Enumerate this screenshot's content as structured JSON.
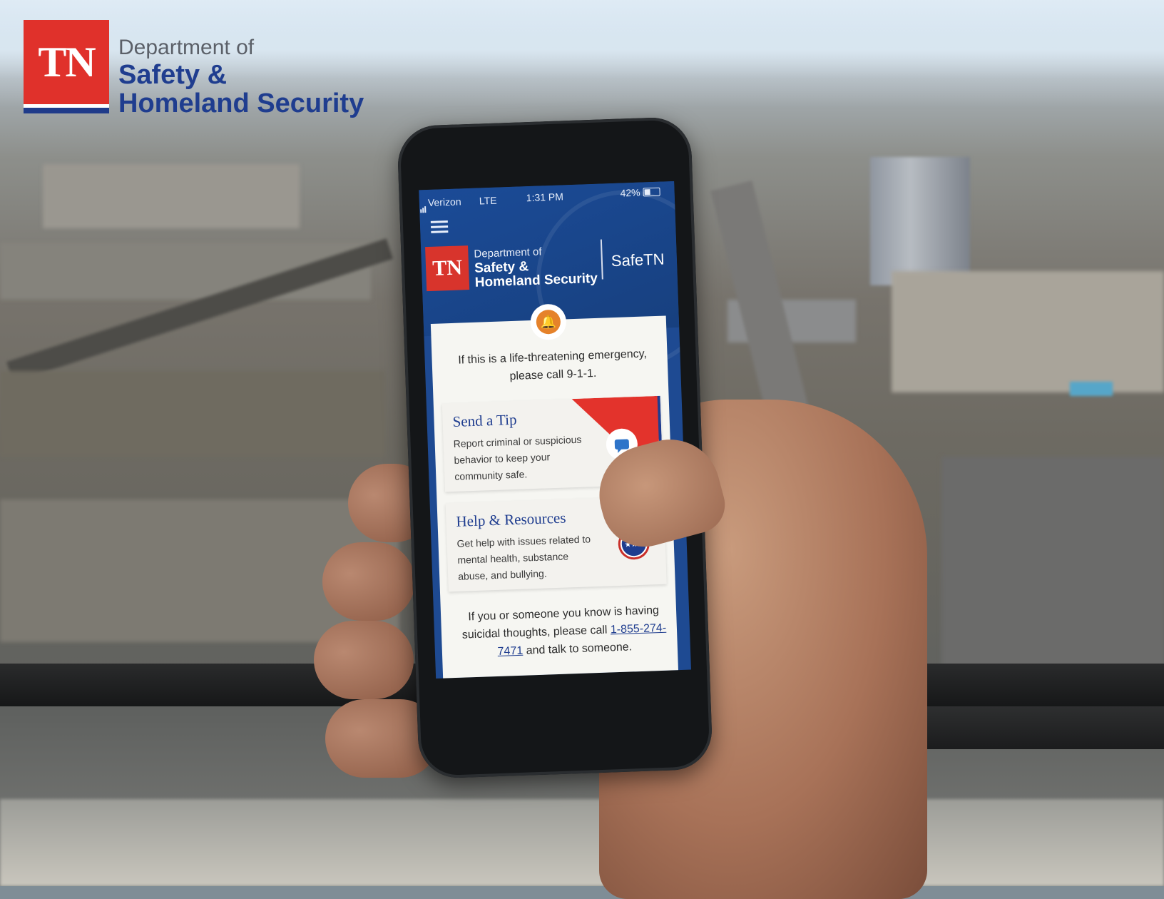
{
  "brand": {
    "badge": "TN",
    "line1": "Department of",
    "line2": "Safety &",
    "line3": "Homeland Security",
    "colors": {
      "red": "#e0312b",
      "blue": "#1f3d8f",
      "gray": "#5b6068"
    }
  },
  "phone": {
    "status_bar": {
      "carrier": "Verizon",
      "network": "LTE",
      "time": "1:31 PM",
      "battery": "42%"
    },
    "app_header": {
      "menu_icon": "hamburger-menu-icon",
      "badge": "TN",
      "line1": "Department of",
      "line2": "Safety &",
      "line3": "Homeland Security",
      "app_name": "SafeTN"
    },
    "alert_icon": "bell-icon",
    "emergency_text": "If this is a life-threatening emergency, please call 9-1-1.",
    "cards": {
      "tip": {
        "title": "Send a Tip",
        "description": "Report criminal or suspicious behavior to keep your community safe.",
        "icon": "chat-bubble-icon"
      },
      "help": {
        "title": "Help & Resources",
        "description": "Get help with issues related to mental health, substance abuse, and bullying.",
        "icon": "tn-tristar-icon"
      }
    },
    "help_note": {
      "before": "If you or someone you know is having suicidal thoughts, please call",
      "phone": "1-855-274-7471",
      "after": "and talk to someone."
    },
    "colors": {
      "header_blue": "#1b4b97",
      "accent_orange": "#e5822a",
      "flag_red": "#e3332c"
    }
  }
}
